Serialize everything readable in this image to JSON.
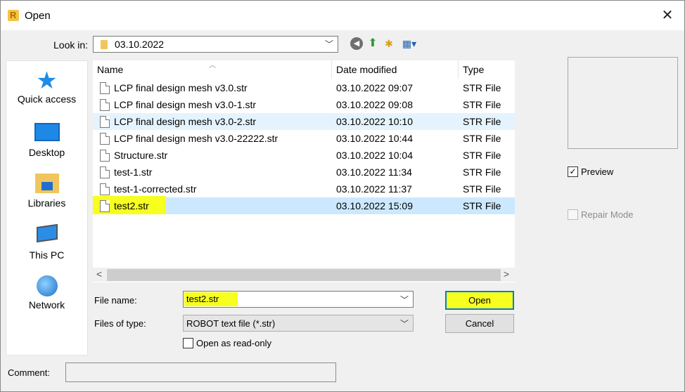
{
  "window": {
    "title": "Open",
    "icon": "robot-app-icon",
    "close": "✕"
  },
  "toolbar": {
    "look_in_label": "Look in:",
    "look_in_value": "03.10.2022",
    "icons": [
      "back-icon",
      "up-folder-icon",
      "new-folder-icon",
      "view-menu-icon"
    ]
  },
  "places": [
    {
      "label": "Quick access",
      "icon": "star-icon"
    },
    {
      "label": "Desktop",
      "icon": "desktop-icon"
    },
    {
      "label": "Libraries",
      "icon": "libraries-icon"
    },
    {
      "label": "This PC",
      "icon": "pc-icon"
    },
    {
      "label": "Network",
      "icon": "network-icon"
    }
  ],
  "columns": {
    "name": "Name",
    "date": "Date modified",
    "type": "Type"
  },
  "files": [
    {
      "name": "LCP final design mesh v3.0.str",
      "date": "03.10.2022 09:07",
      "type": "STR File"
    },
    {
      "name": "LCP final design mesh v3.0-1.str",
      "date": "03.10.2022 09:08",
      "type": "STR File"
    },
    {
      "name": "LCP final design mesh v3.0-2.str",
      "date": "03.10.2022 10:10",
      "type": "STR File"
    },
    {
      "name": "LCP final design mesh v3.0-22222.str",
      "date": "03.10.2022 10:44",
      "type": "STR File"
    },
    {
      "name": "Structure.str",
      "date": "03.10.2022 10:04",
      "type": "STR File"
    },
    {
      "name": "test-1.str",
      "date": "03.10.2022 11:34",
      "type": "STR File"
    },
    {
      "name": "test-1-corrected.str",
      "date": "03.10.2022 11:37",
      "type": "STR File"
    },
    {
      "name": "test2.str",
      "date": "03.10.2022 15:09",
      "type": "STR File"
    }
  ],
  "scroll": {
    "left": "<",
    "right": ">"
  },
  "right_panel": {
    "preview_label": "Preview",
    "preview_checked": true,
    "repair_label": "Repair Mode",
    "repair_checked": false
  },
  "form": {
    "file_name_label": "File name:",
    "file_name_value": "test2.str",
    "file_type_label": "Files of type:",
    "file_type_value": "ROBOT text file (*.str)",
    "readonly_label": "Open as read-only",
    "open_button": "Open",
    "cancel_button": "Cancel",
    "comment_label": "Comment:"
  },
  "colors": {
    "highlight": "#f7ff1f",
    "selected": "#cce8ff",
    "accent": "#0078d7"
  }
}
